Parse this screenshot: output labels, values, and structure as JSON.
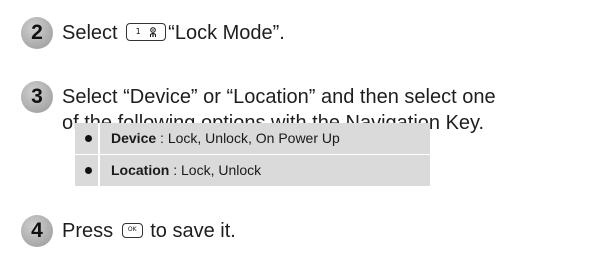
{
  "steps": [
    {
      "number": "2",
      "before_key": "Select ",
      "key_label": "1",
      "key_icon": "voicemail-icon",
      "after_key": "“Lock Mode”."
    },
    {
      "number": "3",
      "line1": "Select “Device” or “Location” and then select one",
      "line2": "of the following options with the Navigation Key."
    },
    {
      "number": "4",
      "before_key": "Press ",
      "key_label": "OK",
      "after_key": " to save it."
    }
  ],
  "options": [
    {
      "term": "Device",
      "desc": " : Lock, Unlock, On Power Up"
    },
    {
      "term": "Location",
      "desc": " : Lock, Unlock"
    }
  ],
  "colors": {
    "badge": "#a8a8a8",
    "options_bg": "#dadada",
    "text": "#1e1e1e"
  }
}
